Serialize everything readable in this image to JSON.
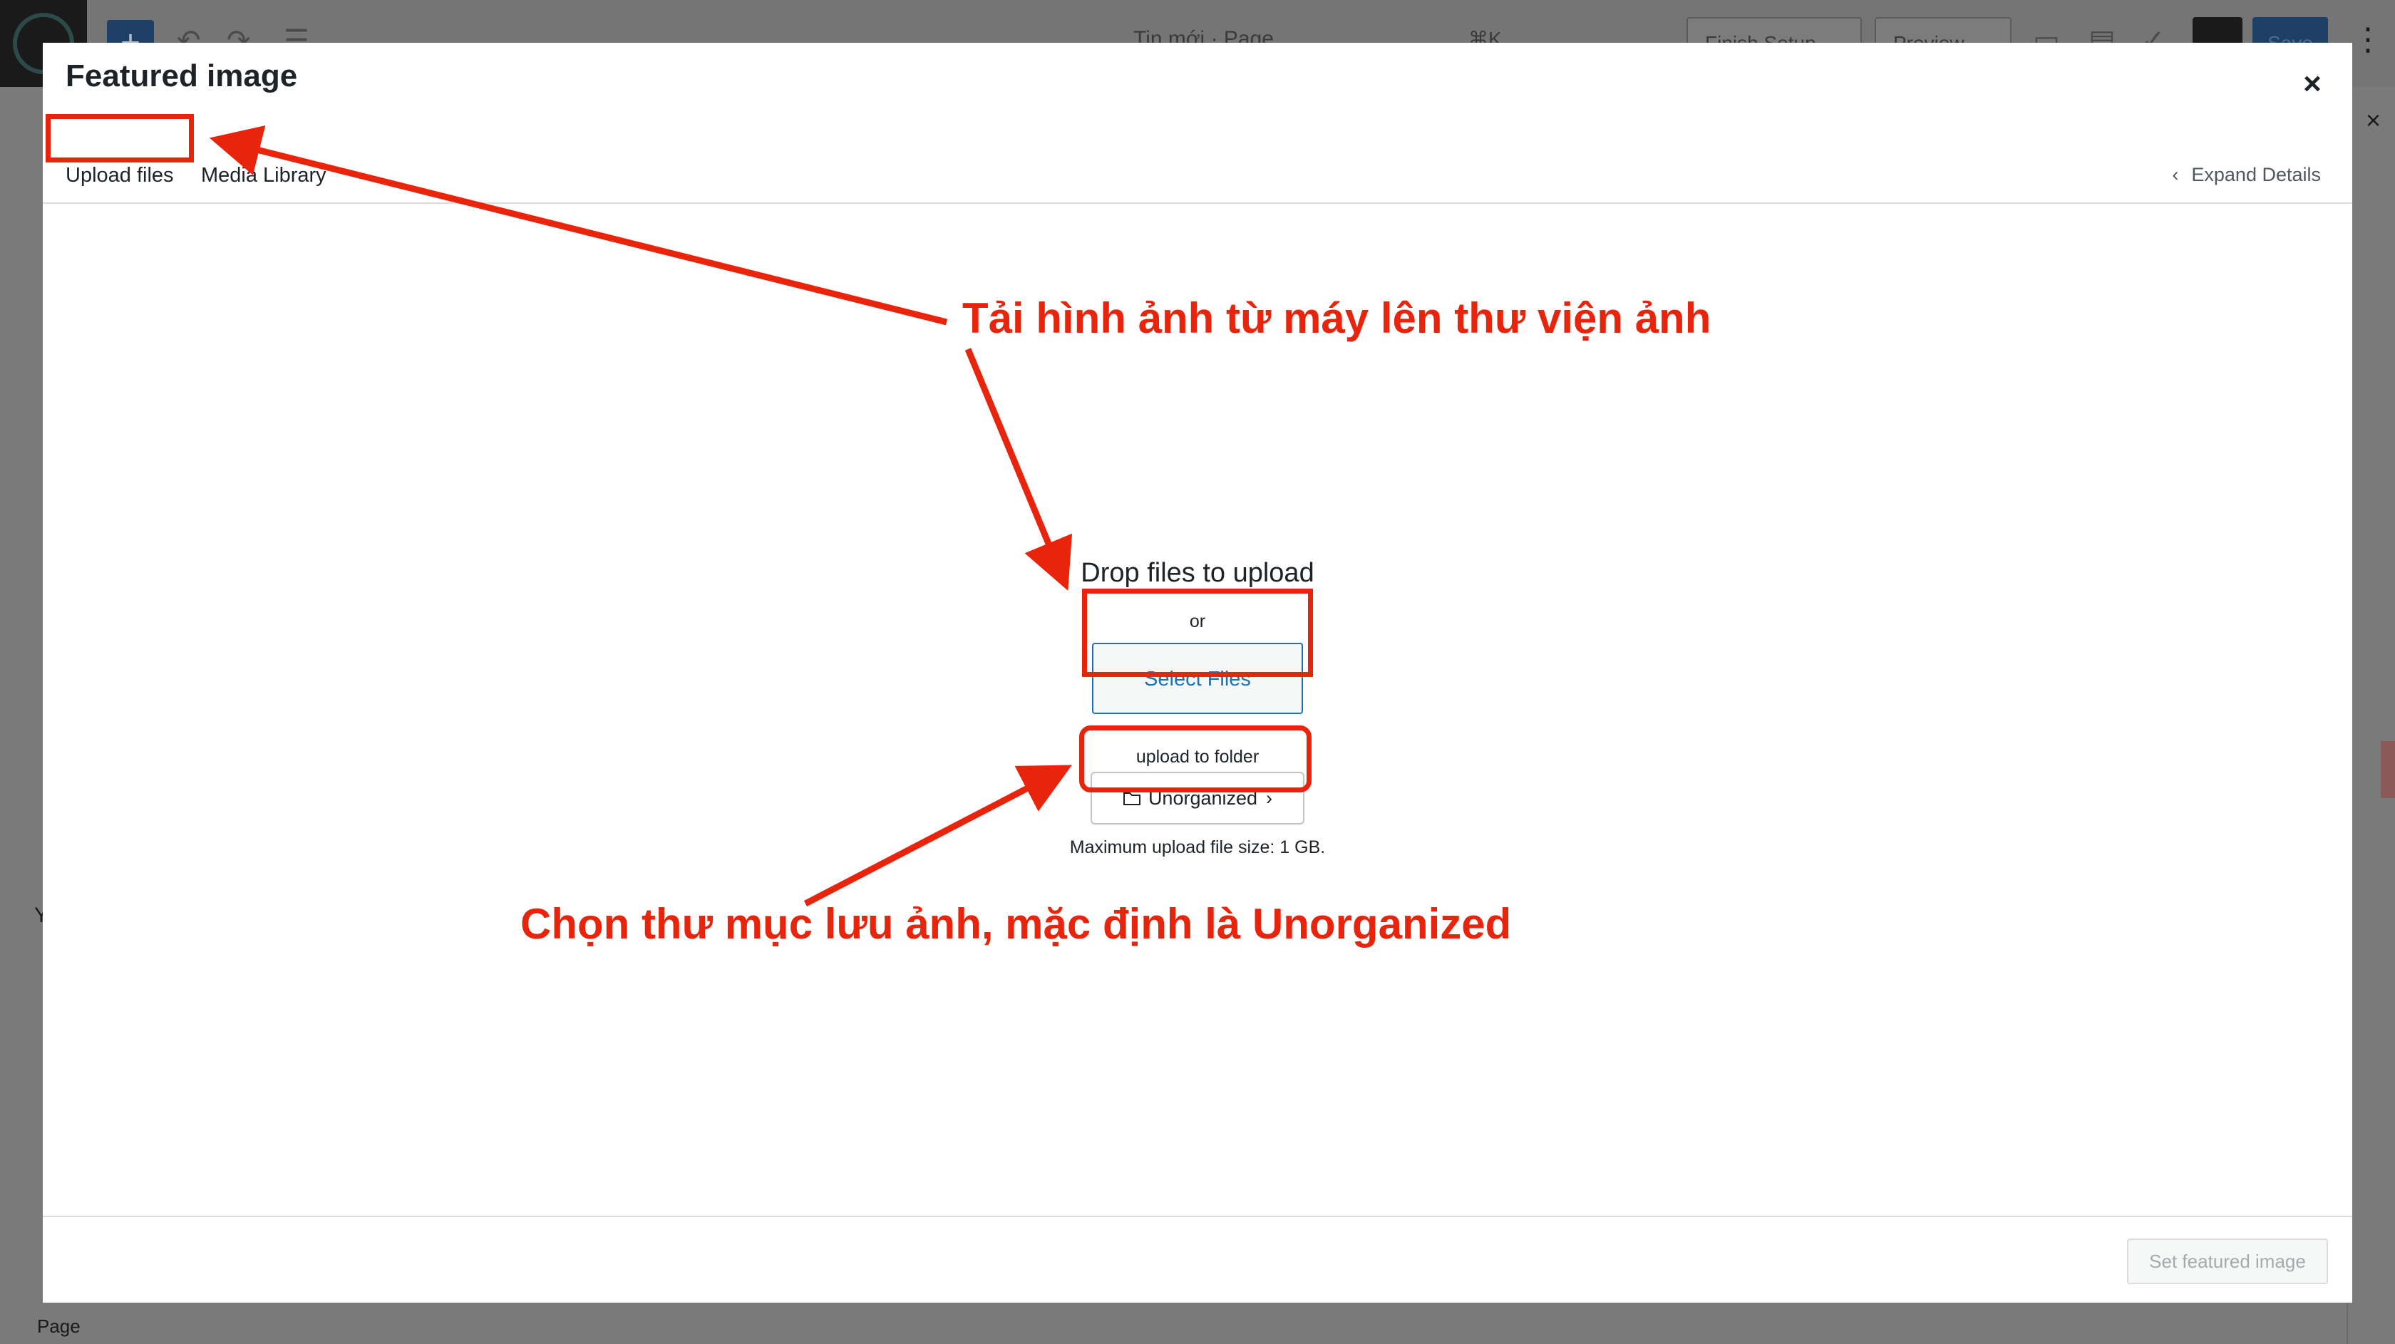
{
  "background": {
    "doc_title": "Tin mới · Page",
    "shortcut": "⌘K",
    "finish_setup_label": "Finish Setup",
    "preview_label": "Preview",
    "save_label": "Save",
    "footer_breadcrumb": "Page",
    "left_fragment": "Y"
  },
  "modal": {
    "title": "Featured image",
    "close_glyph": "×",
    "tabs": [
      {
        "label": "Upload files",
        "active": true
      },
      {
        "label": "Media Library",
        "active": false
      }
    ],
    "expand_details_label": "Expand Details",
    "uploader": {
      "instructions": "Drop files to upload",
      "or_text": "or",
      "select_files_label": "Select Files",
      "folder_label": "upload to folder",
      "folder_value": "Unorganized",
      "max_size_text": "Maximum upload file size: 1 GB."
    },
    "footer": {
      "set_featured_label": "Set featured image"
    }
  },
  "annotations": {
    "upload_note": "Tải hình ảnh từ máy lên thư viện ảnh",
    "folder_note": "Chọn thư mục lưu ảnh, mặc định là Unorganized"
  },
  "colors": {
    "annotation_red": "#e8250c",
    "primary_blue": "#2271b1",
    "text_dark": "#1d2327"
  }
}
